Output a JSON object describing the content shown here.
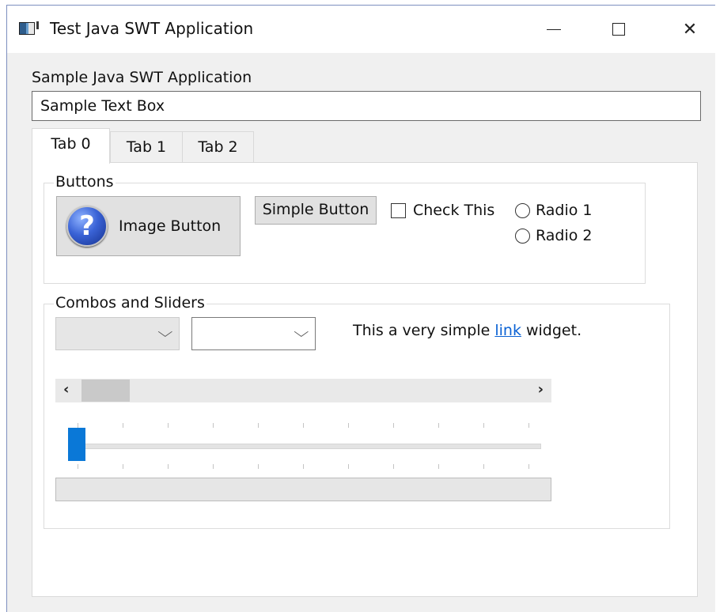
{
  "window": {
    "title": "Test Java SWT Application",
    "controls": {
      "minimize": "minimize",
      "maximize": "maximize",
      "close": "✕"
    }
  },
  "content": {
    "label": "Sample Java SWT Application",
    "text_box_value": "Sample Text Box"
  },
  "tabs": [
    {
      "label": "Tab 0",
      "active": true
    },
    {
      "label": "Tab 1",
      "active": false
    },
    {
      "label": "Tab 2",
      "active": false
    }
  ],
  "buttons_group": {
    "label": "Buttons",
    "image_button_label": "Image Button",
    "image_button_icon": "question-icon",
    "image_button_glyph": "?",
    "simple_button_label": "Simple Button",
    "checkbox_label": "Check This",
    "checkbox_checked": false,
    "radio1_label": "Radio 1",
    "radio2_label": "Radio 2"
  },
  "combos_group": {
    "label": "Combos and Sliders",
    "combo1_value": "",
    "combo2_value": "",
    "link_prefix": "This a very simple ",
    "link_text": "link",
    "link_suffix": " widget.",
    "scroll_left": "‹",
    "scroll_right": "›",
    "slider_value_fraction": 0,
    "progress_fraction": 0
  },
  "colors": {
    "accent": "#0a78d7",
    "link": "#0b62d4"
  }
}
